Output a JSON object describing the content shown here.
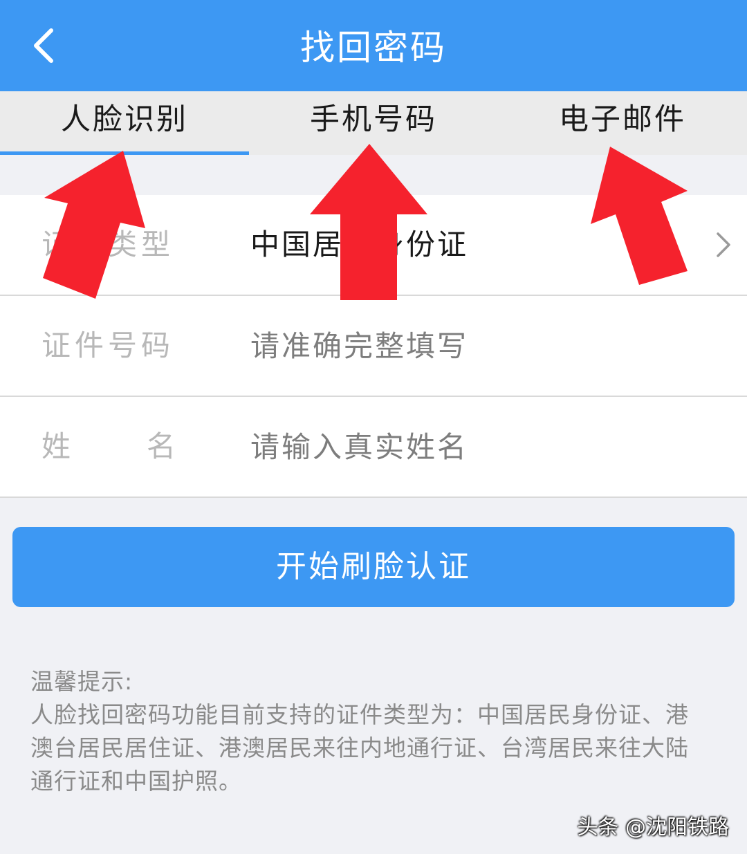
{
  "header": {
    "title": "找回密码",
    "back_icon": "chevron-left-icon"
  },
  "tabs": [
    {
      "label": "人脸识别",
      "active": true
    },
    {
      "label": "手机号码",
      "active": false
    },
    {
      "label": "电子邮件",
      "active": false
    }
  ],
  "form": {
    "id_type": {
      "label": "证件类型",
      "value": "中国居民身份证",
      "icon": "chevron-right-icon"
    },
    "id_number": {
      "label": "证件号码",
      "placeholder": "请准确完整填写"
    },
    "name": {
      "label_first": "姓",
      "label_second": "名",
      "placeholder": "请输入真实姓名"
    }
  },
  "primary_button": {
    "label": "开始刷脸认证"
  },
  "tips": {
    "title": "温馨提示:",
    "body": "人脸找回密码功能目前支持的证件类型为：中国居民身份证、港澳台居民居住证、港澳居民来往内地通行证、台湾居民来往大陆通行证和中国护照。"
  },
  "watermark": "头条 @沈阳铁路",
  "colors": {
    "accent": "#3d98f3",
    "annotation_arrow": "#f5222d",
    "background": "#f0f1f5"
  }
}
